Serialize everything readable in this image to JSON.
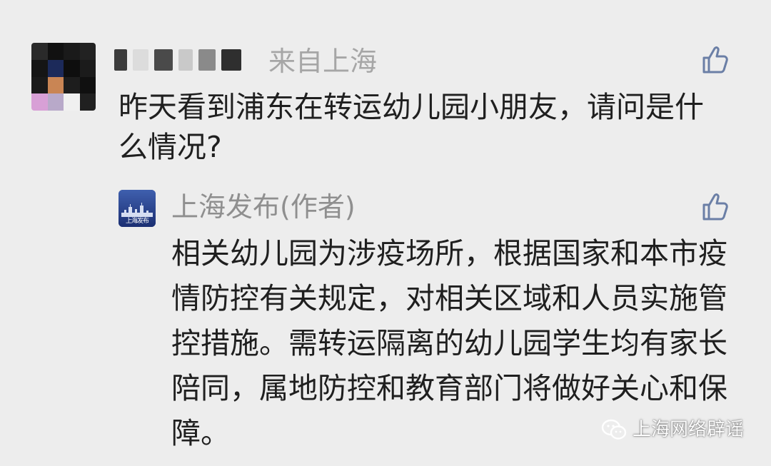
{
  "comment": {
    "location": "来自上海",
    "text": "昨天看到浦东在转运幼儿园小朋友，请问是什么情况?"
  },
  "reply": {
    "author": "上海发布(作者)",
    "avatar_label": "上海发布",
    "text": "相关幼儿园为涉疫场所，根据国家和本市疫情防控有关规定，对相关区域和人员实施管控措施。需转运隔离的幼儿园学生均有家长陪同，属地防控和教育部门将做好关心和保障。"
  },
  "watermark": {
    "text": "上海网络辟谣"
  },
  "icons": {
    "like": "thumbs-up-icon",
    "watermark": "wechat-logo-icon"
  },
  "colors": {
    "background": "#ededed",
    "like_icon": "#6b7fa6",
    "secondary_text": "#a6a6a6",
    "body_text": "#1f1f1f"
  }
}
